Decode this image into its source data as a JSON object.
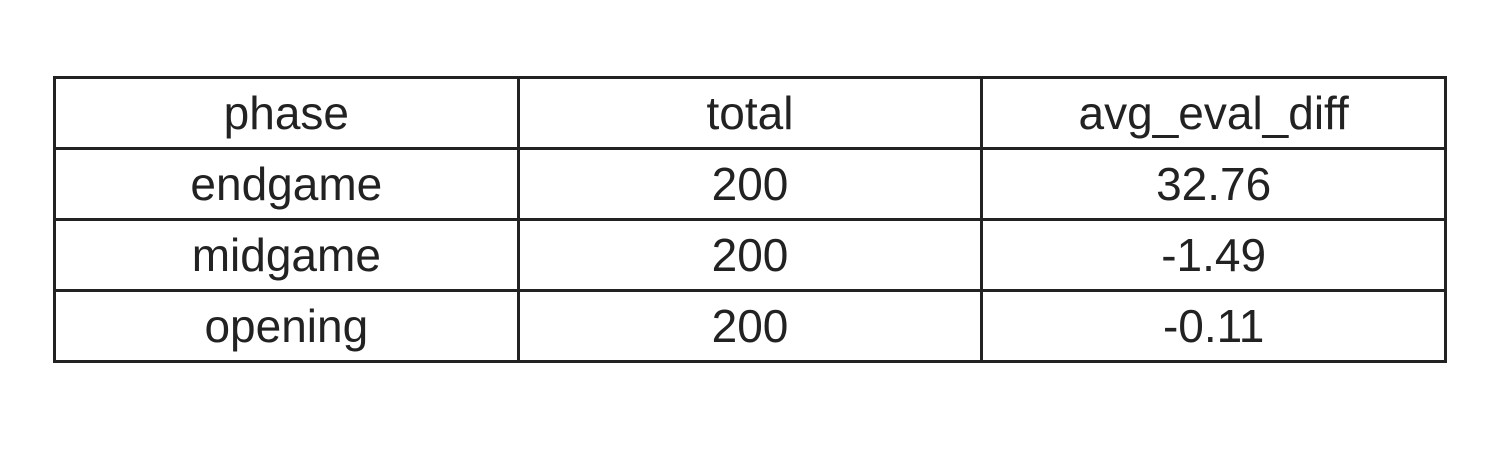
{
  "chart_data": {
    "type": "table",
    "columns": [
      "phase",
      "total",
      "avg_eval_diff"
    ],
    "rows": [
      [
        "endgame",
        "200",
        "32.76"
      ],
      [
        "midgame",
        "200",
        "-1.49"
      ],
      [
        "opening",
        "200",
        "-0.11"
      ]
    ]
  }
}
